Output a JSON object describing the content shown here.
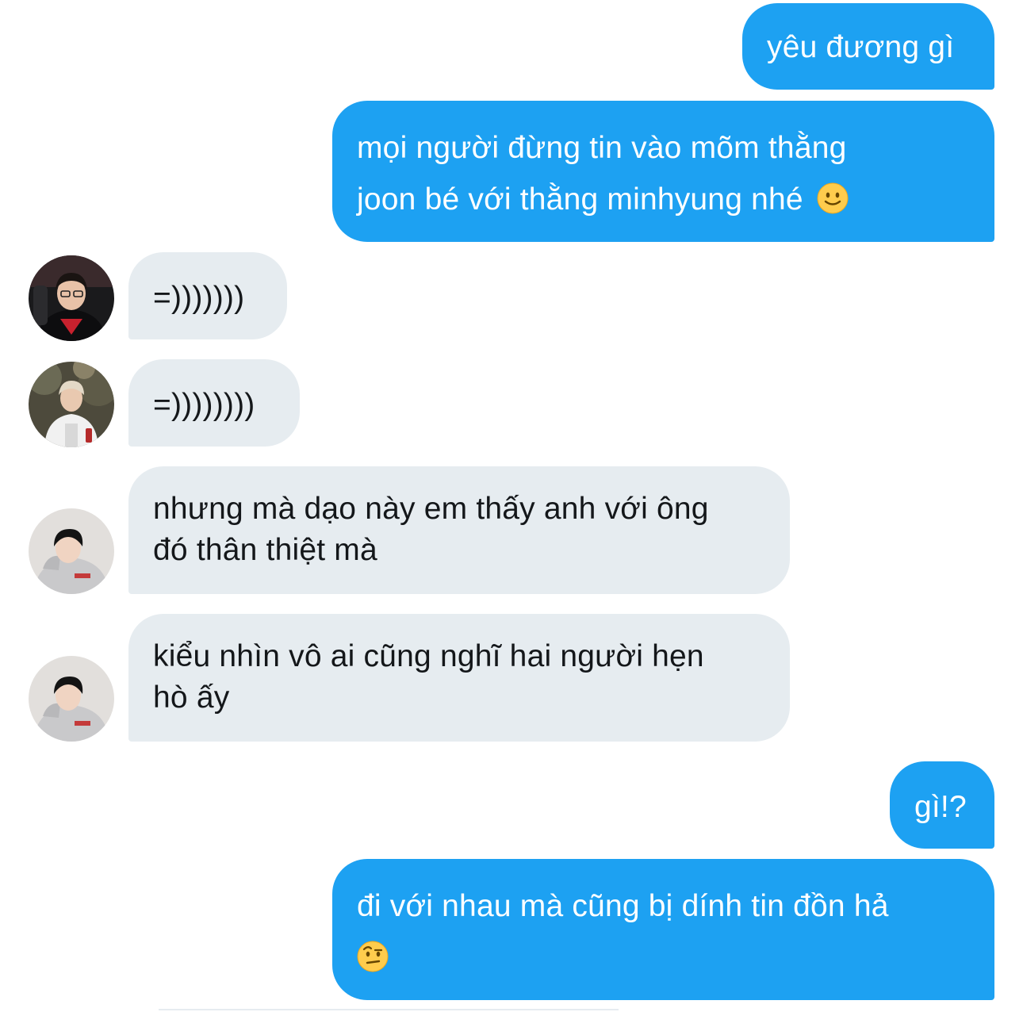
{
  "colors": {
    "sent_bubble": "#1da1f2",
    "received_bubble": "#e6ecf0",
    "sent_text": "#ffffff",
    "received_text": "#14171a"
  },
  "messages": [
    {
      "direction": "sent",
      "text": "yêu đương gì"
    },
    {
      "direction": "sent",
      "line1": "mọi người đừng tin vào mõm thằng",
      "line2": "joon bé với thằng minhyung nhé",
      "emoji": "slightly-smiling-face-icon"
    },
    {
      "direction": "received",
      "avatar": "avatar-gamer-red-jersey",
      "text": "=)))))))"
    },
    {
      "direction": "received",
      "avatar": "avatar-white-jacket-outdoor",
      "text": "=))))))))"
    },
    {
      "direction": "received",
      "avatar": "avatar-grey-hoodie",
      "line1": "nhưng mà dạo này em thấy anh với ông",
      "line2": "đó thân thiệt mà"
    },
    {
      "direction": "received",
      "avatar": "avatar-grey-hoodie",
      "line1": "kiểu nhìn vô ai cũng nghĩ hai người hẹn",
      "line2": "hò ấy"
    },
    {
      "direction": "sent",
      "text": "gì!?"
    },
    {
      "direction": "sent",
      "line1": "đi với nhau mà cũng bị dính tin đồn hả",
      "emoji": "face-with-raised-eyebrow-icon"
    }
  ]
}
